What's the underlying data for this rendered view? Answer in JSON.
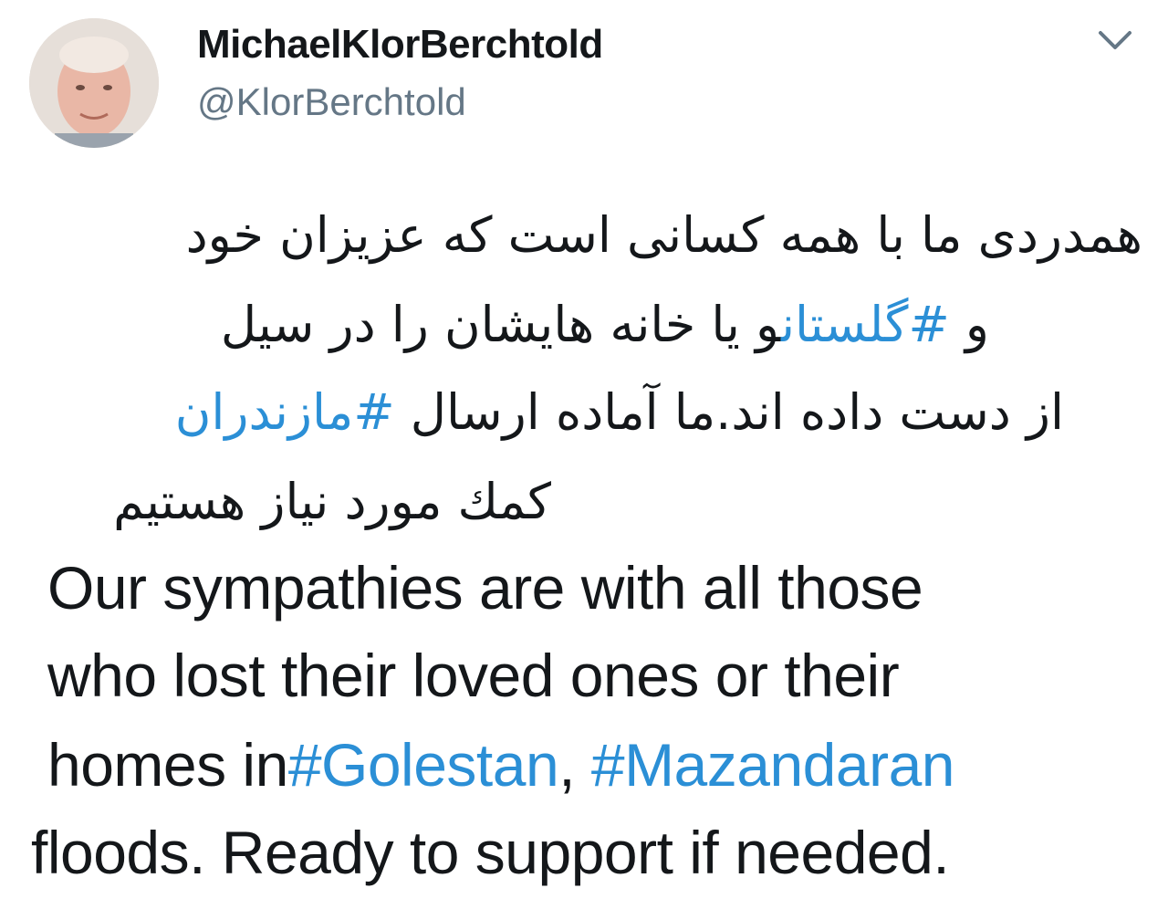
{
  "user": {
    "display_name": "MichaelKlorBerchtold",
    "handle": "@KlorBerchtold"
  },
  "icons": {
    "avatar": "profile-photo",
    "menu": "chevron-down-icon"
  },
  "colors": {
    "text": "#14171a",
    "handle": "#657786",
    "hashtag": "#2b8fd6"
  },
  "tweet": {
    "fa": {
      "line1": "همدردی ما با همه کسانی است که عزیزان خود",
      "line2_pre": "و ",
      "line2_tag": "#گلستان",
      "line2_post": "و یا خانه هایشان را در سیل",
      "line3_pre": "از دست داده اند.ما آماده ارسال  ",
      "line3_tag": "#مازندران",
      "line4": "کمك مورد نیاز هستیم"
    },
    "en": {
      "line1": "Our sympathies are with all those",
      "line2": "who lost their loved ones or their",
      "line3_pre": "homes in",
      "line3_tag1": "#Golestan",
      "line3_mid": ",  ",
      "line3_tag2": "#Mazandaran",
      "line4": "floods. Ready to support if needed."
    }
  }
}
